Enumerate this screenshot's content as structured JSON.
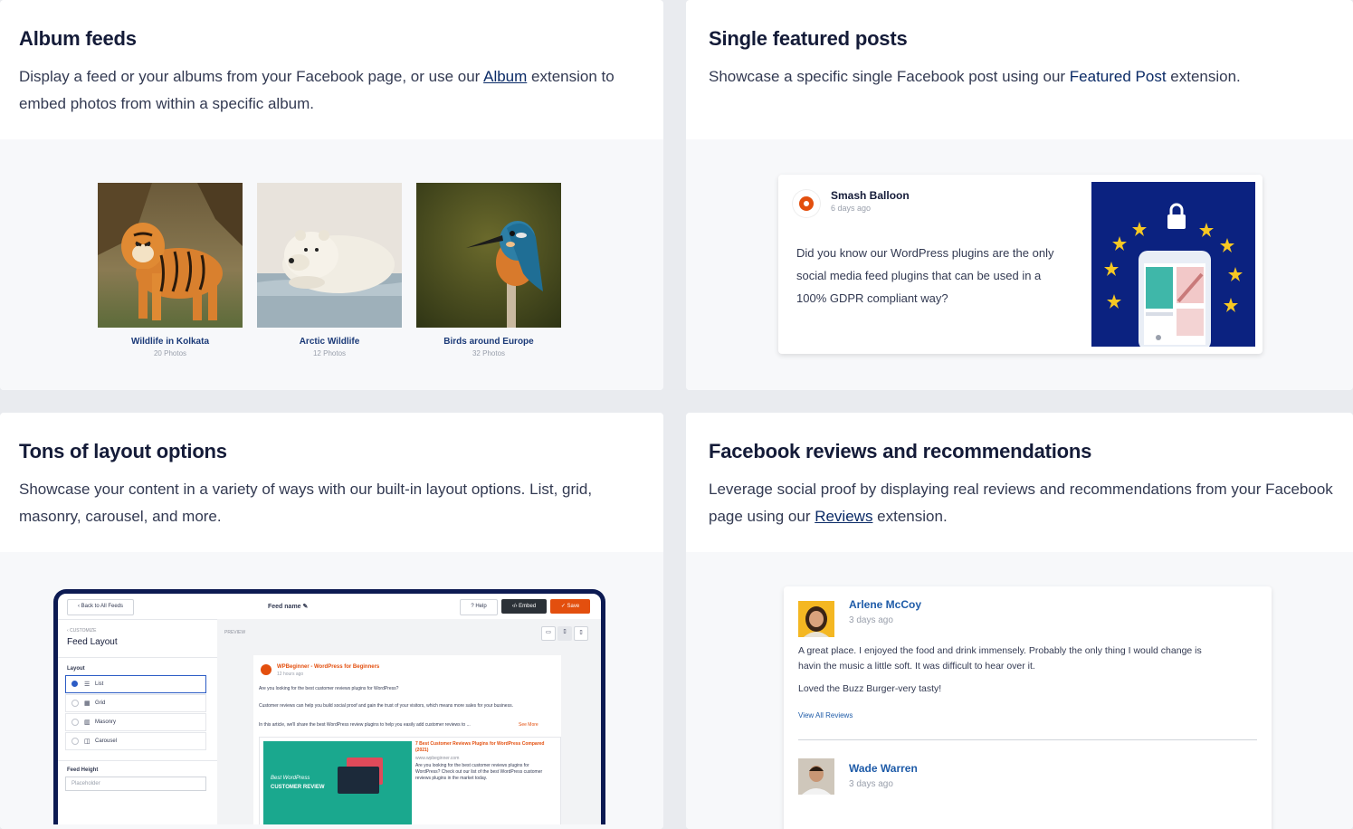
{
  "cards": {
    "album": {
      "title": "Album feeds",
      "desc_pre": "Display a feed or your albums from your Facebook page, or use our ",
      "desc_link": "Album",
      "desc_post": " extension to embed photos from within a specific album.",
      "albums": [
        {
          "name": "Wildlife in Kolkata",
          "count": "20 Photos"
        },
        {
          "name": "Arctic Wildlife",
          "count": "12 Photos"
        },
        {
          "name": "Birds around Europe",
          "count": "32 Photos"
        }
      ]
    },
    "featured": {
      "title": "Single featured posts",
      "desc_pre": "Showcase a specific single Facebook post using our ",
      "desc_link": "Featured Post",
      "desc_post": " extension.",
      "post": {
        "author": "Smash Balloon",
        "time": "6 days ago",
        "text": "Did you know our WordPress plugins are the only social media feed plugins that can be used in a 100% GDPR compliant way?"
      }
    },
    "layout": {
      "title": "Tons of layout options",
      "desc": "Showcase your content in a variety of ways with our built-in layout options. List, grid, masonry, carousel, and more.",
      "app": {
        "back": "‹ Back to All Feeds",
        "feed_name": "Feed name ✎",
        "help": "? Help",
        "embed": "‹/› Embed",
        "save": "✓ Save",
        "customize": "‹ CUSTOMIZE",
        "panel_title": "Feed Layout",
        "layout_label": "Layout",
        "options": [
          "List",
          "Grid",
          "Masonry",
          "Carousel"
        ],
        "feed_height": "Feed Height",
        "feed_height_placeholder": "Placeholder",
        "preview_label": "PREVIEW",
        "post_author": "WPBeginner - WordPress for Beginners",
        "post_time": "12 hours ago",
        "post_line1": "Are you looking for the best customer reviews plugins for WordPress?",
        "post_line2": "Customer reviews can help you build social proof and gain the trust of your visitors, which means more sales for your business.",
        "post_line3": "In this article, we'll share the best WordPress review plugins to help you easily add customer reviews to ...",
        "see_more": "See More",
        "link_title": "7 Best Customer Reviews Plugins for WordPress Compared (2021)",
        "link_domain": "www.wpbeginner.com",
        "link_desc": "Are you looking for the best customer reviews plugins for WordPress? Check out our list of the best WordPress customer reviews plugins in the market today.",
        "thumb_text1": "Best WordPress",
        "thumb_text2": "CUSTOMER REVIEW"
      }
    },
    "reviews": {
      "title": "Facebook reviews and recommendations",
      "desc_pre": "Leverage social proof by displaying real reviews and recommendations from your Facebook page using our ",
      "desc_link": "Reviews",
      "desc_post": " extension.",
      "items": [
        {
          "name": "Arlene McCoy",
          "time": "3 days ago",
          "text1": "A great place. I enjoyed the food and drink immensely. Probably the only thing I would change is havin the music a little soft. It was difficult to hear over it.",
          "text2": "Loved the Buzz Burger-very tasty!",
          "link": "View All Reviews"
        },
        {
          "name": "Wade Warren",
          "time": "3 days ago"
        }
      ]
    }
  },
  "colors": {
    "page_bg": "#e9ebef",
    "title": "#141b38",
    "link": "#0a2a66",
    "accent_orange": "#e34f0e",
    "navy": "#0b2280"
  }
}
